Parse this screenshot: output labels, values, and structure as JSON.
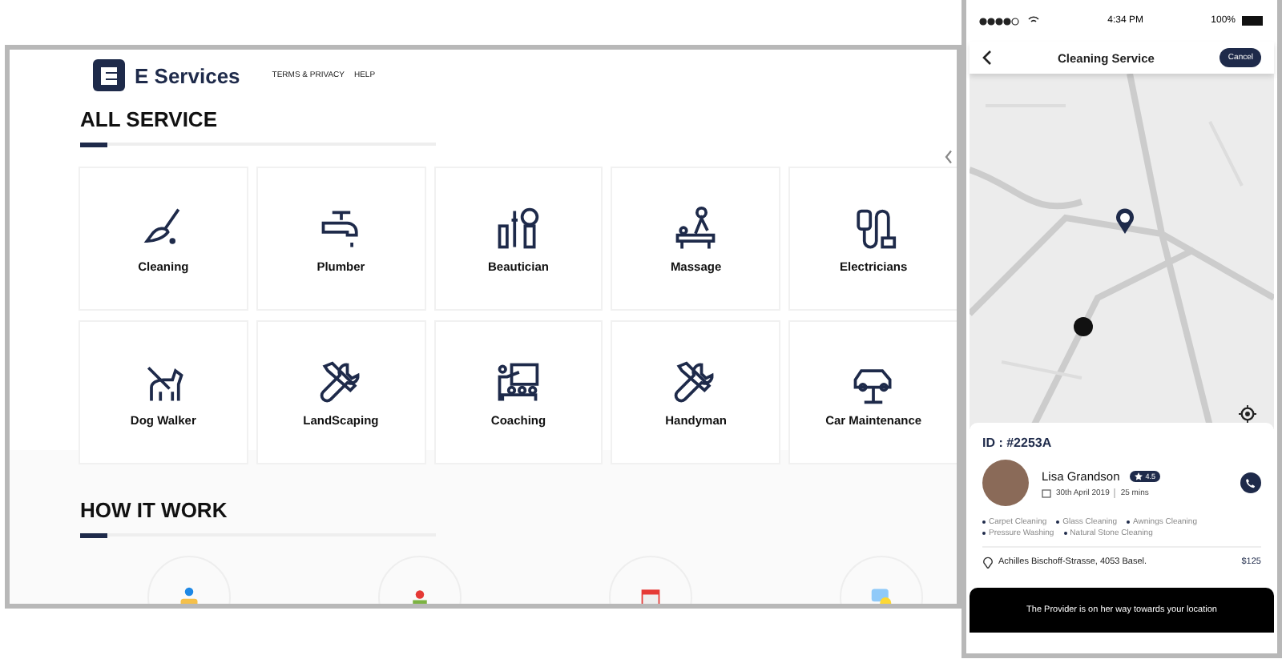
{
  "site": {
    "brand": "E Services",
    "nav": [
      "TERMS & PRIVACY",
      "HELP"
    ],
    "services_title": "ALL SERVICE",
    "services": [
      {
        "label": "Cleaning"
      },
      {
        "label": "Plumber"
      },
      {
        "label": "Beautician"
      },
      {
        "label": "Massage"
      },
      {
        "label": "Electricians"
      },
      {
        "label": "Dog Walker"
      },
      {
        "label": "LandScaping"
      },
      {
        "label": "Coaching"
      },
      {
        "label": "Handyman"
      },
      {
        "label": "Car Maintenance"
      }
    ],
    "how_title": "HOW IT WORK"
  },
  "phone": {
    "status": {
      "time": "4:34 PM",
      "battery": "100%"
    },
    "title": "Cleaning Service",
    "cancel": "Cancel",
    "booking": {
      "id": "ID : #2253A",
      "name": "Lisa Grandson",
      "rating": "4.5",
      "date": "30th April 2019",
      "duration": "25 mins",
      "tasks": [
        "Carpet Cleaning",
        "Glass Cleaning",
        "Awnings Cleaning",
        "Pressure Washing",
        "Natural Stone Cleaning"
      ],
      "address": "Achilles Bischoff-Strasse, 4053 Basel.",
      "price": "$125"
    },
    "banner": "The Provider is on her way towards your location"
  }
}
